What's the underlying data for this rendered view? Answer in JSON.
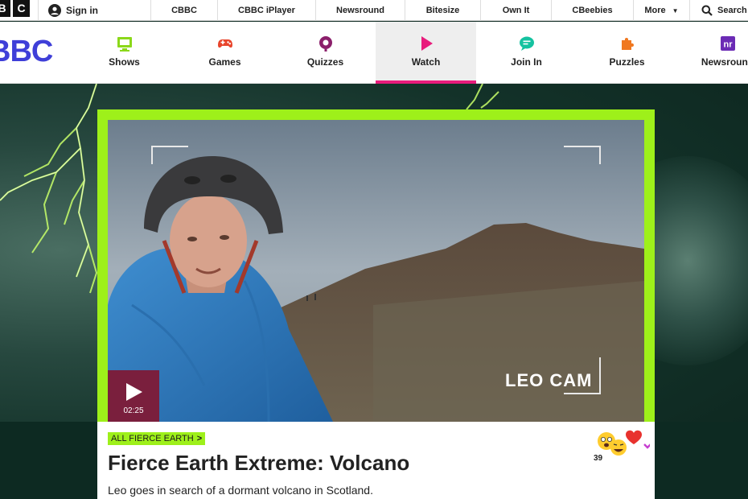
{
  "topbar": {
    "logo_letters": [
      "B",
      "C"
    ],
    "signin_label": "Sign in",
    "links": [
      "CBBC",
      "CBBC iPlayer",
      "Newsround",
      "Bitesize",
      "Own It",
      "CBeebies",
      "More"
    ],
    "search_label": "Search"
  },
  "cbbc": {
    "logo_text": "BBC",
    "logo_color": "#3f3fd8",
    "nav": [
      {
        "label": "Shows",
        "icon": "tv-icon",
        "color": "#8bd81a"
      },
      {
        "label": "Games",
        "icon": "gamepad-icon",
        "color": "#e8452c"
      },
      {
        "label": "Quizzes",
        "icon": "quiz-icon",
        "color": "#8b1f6b"
      },
      {
        "label": "Watch",
        "icon": "play-icon",
        "color": "#e81c7c",
        "active": true
      },
      {
        "label": "Join In",
        "icon": "chat-icon",
        "color": "#15c2a0"
      },
      {
        "label": "Puzzles",
        "icon": "puzzle-icon",
        "color": "#f07820"
      },
      {
        "label": "Newsround",
        "icon": "newsround-icon",
        "color": "#6b2bb5"
      }
    ]
  },
  "player": {
    "overlay_text": "LEO CAM",
    "duration": "02:25",
    "frame_color": "#9ef01a"
  },
  "episode": {
    "collection_label": "ALL FIERCE EARTH",
    "title": "Fierce Earth Extreme: Volcano",
    "description": "Leo goes in search of a dormant volcano in Scotland.",
    "reaction_count": "39"
  }
}
